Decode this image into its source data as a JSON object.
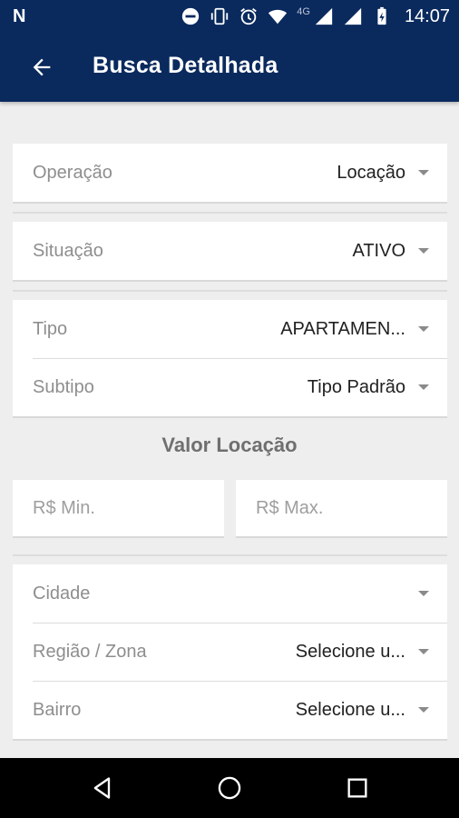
{
  "status_bar": {
    "carrier_icon": "N",
    "network": "4G",
    "time": "14:07",
    "icons": [
      "do-not-disturb-icon",
      "vibrate-icon",
      "alarm-icon",
      "wifi-icon",
      "signal-icon",
      "signal-icon",
      "battery-charging-icon"
    ]
  },
  "app_bar": {
    "title": "Busca Detalhada",
    "back_icon": "arrow-back-icon"
  },
  "form": {
    "operacao": {
      "label": "Operação",
      "value": "Locação"
    },
    "situacao": {
      "label": "Situação",
      "value": "ATIVO"
    },
    "tipo": {
      "label": "Tipo",
      "value": "APARTAMEN..."
    },
    "subtipo": {
      "label": "Subtipo",
      "value": "Tipo Padrão"
    },
    "valor_section": "Valor Locação",
    "min_placeholder": "R$ Min.",
    "max_placeholder": "R$ Max.",
    "cidade": {
      "label": "Cidade",
      "value": ""
    },
    "regiao": {
      "label": "Região / Zona",
      "value": "Selecione u..."
    },
    "bairro": {
      "label": "Bairro",
      "value": "Selecione u..."
    }
  },
  "nav_bar": {
    "icons": [
      "back-triangle-icon",
      "home-circle-icon",
      "recents-square-icon"
    ]
  },
  "colors": {
    "primary": "#0a2a5e",
    "background": "#eeeeee",
    "label": "#8e8e8e",
    "value": "#212121"
  }
}
